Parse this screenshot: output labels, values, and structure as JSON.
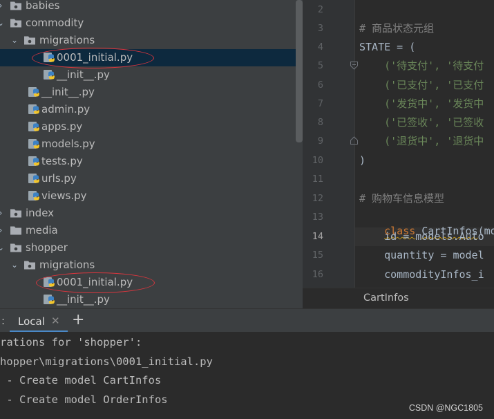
{
  "project_tree": {
    "items": [
      {
        "label": "babies",
        "type": "package",
        "state": "collapsed"
      },
      {
        "label": "commodity",
        "type": "package",
        "state": "expanded"
      },
      {
        "label": "migrations",
        "type": "package",
        "state": "expanded"
      },
      {
        "label": "0001_initial.py",
        "type": "python-file"
      },
      {
        "label": "__init__.py",
        "type": "python-file"
      },
      {
        "label": "__init__.py",
        "type": "python-file"
      },
      {
        "label": "admin.py",
        "type": "python-file"
      },
      {
        "label": "apps.py",
        "type": "python-file"
      },
      {
        "label": "models.py",
        "type": "python-file"
      },
      {
        "label": "tests.py",
        "type": "python-file"
      },
      {
        "label": "urls.py",
        "type": "python-file"
      },
      {
        "label": "views.py",
        "type": "python-file"
      },
      {
        "label": "index",
        "type": "package",
        "state": "collapsed"
      },
      {
        "label": "media",
        "type": "folder",
        "state": "collapsed"
      },
      {
        "label": "shopper",
        "type": "package",
        "state": "expanded"
      },
      {
        "label": "migrations",
        "type": "package",
        "state": "expanded"
      },
      {
        "label": "0001_initial.py",
        "type": "python-file"
      },
      {
        "label": "__init__.py",
        "type": "python-file"
      }
    ],
    "selected_index": 3,
    "highlighted_indices": [
      3,
      16
    ]
  },
  "editor": {
    "line_numbers": [
      "2",
      "3",
      "4",
      "5",
      "6",
      "7",
      "8",
      "9",
      "10",
      "11",
      "12",
      "13",
      "14",
      "15",
      "16"
    ],
    "current_line": "14",
    "lines": {
      "l3": "# 商品状态元组",
      "l4": "STATE = (",
      "l5": "    ('待支付', '待支付",
      "l6": "    ('已支付', '已支付",
      "l7": "    ('发货中', '发货中",
      "l8": "    ('已签收', '已签收",
      "l9": "    ('退货中', '退货中",
      "l10": ")",
      "l12": "# 购物车信息模型",
      "l13_kw": "class",
      "l13_name": "CartInfos",
      "l13_rest": "(mode",
      "l14": "    id = models.Auto",
      "l15": "    quantity = model",
      "l16": "    commodityInfos_i"
    },
    "breadcrumb": "CartInfos"
  },
  "terminal": {
    "tab_label": "Local",
    "tab_separator": ":",
    "close_glyph": "✕",
    "add_glyph": "+",
    "lines": [
      "rations for 'shopper':",
      "hopper\\migrations\\0001_initial.py",
      " - Create model CartInfos",
      " - Create model OrderInfos"
    ]
  },
  "watermark": "CSDN @NGC1805",
  "colors": {
    "highlight_ellipse": "#d9363e",
    "selection": "#0d293e",
    "keyword": "#cc7832",
    "string": "#6a8759",
    "comment": "#808080",
    "tab_underline": "#4a88c7"
  }
}
